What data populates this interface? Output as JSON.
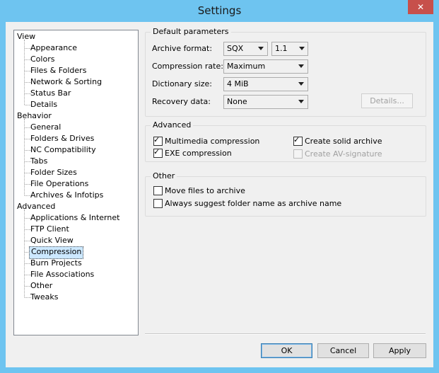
{
  "window": {
    "title": "Settings",
    "close_glyph": "✕",
    "close_icon": "close-icon"
  },
  "tree": [
    {
      "label": "View",
      "children": [
        "Appearance",
        "Colors",
        "Files & Folders",
        "Network & Sorting",
        "Status Bar",
        "Details"
      ]
    },
    {
      "label": "Behavior",
      "children": [
        "General",
        "Folders & Drives",
        "NC Compatibility",
        "Tabs",
        "Folder Sizes",
        "File Operations",
        "Archives & Infotips"
      ]
    },
    {
      "label": "Advanced",
      "children": [
        "Applications & Internet",
        "FTP Client",
        "Quick View",
        "Compression",
        "Burn Projects",
        "File Associations",
        "Other",
        "Tweaks"
      ]
    }
  ],
  "selected_item": "Compression",
  "default_params": {
    "title": "Default parameters",
    "archive_format_label": "Archive format:",
    "archive_format_value": "SQX",
    "archive_version_value": "1.1",
    "compression_rate_label": "Compression rate:",
    "compression_rate_value": "Maximum",
    "dictionary_size_label": "Dictionary size:",
    "dictionary_size_value": "4 MiB",
    "recovery_data_label": "Recovery data:",
    "recovery_data_value": "None",
    "details_button": "Details..."
  },
  "advanced": {
    "title": "Advanced",
    "multimedia_compression": {
      "label": "Multimedia compression",
      "checked": true
    },
    "exe_compression": {
      "label": "EXE compression",
      "checked": true
    },
    "create_solid_archive": {
      "label": "Create solid archive",
      "checked": true
    },
    "create_av_signature": {
      "label": "Create AV-signature",
      "checked": false,
      "disabled": true
    }
  },
  "other": {
    "title": "Other",
    "move_files": {
      "label": "Move files to archive",
      "checked": false
    },
    "suggest_folder_name": {
      "label": "Always suggest folder name as archive name",
      "checked": false
    }
  },
  "buttons": {
    "ok": "OK",
    "cancel": "Cancel",
    "apply": "Apply"
  },
  "colors": {
    "frame": "#6ec4f0",
    "close": "#c7504b",
    "selection": "#cce8ff"
  }
}
